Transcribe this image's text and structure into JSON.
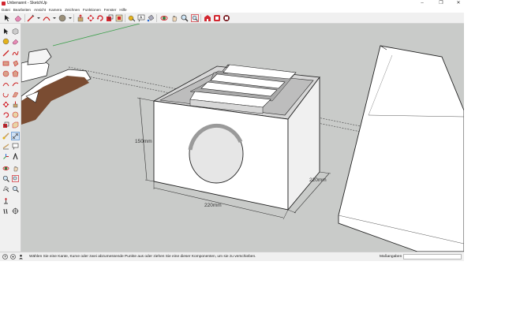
{
  "window": {
    "title": "Unbenannt - SketchUp",
    "min_glyph": "–",
    "max_glyph": "❐",
    "close_glyph": "✕"
  },
  "menu": [
    "Datei",
    "Bearbeiten",
    "Ansicht",
    "Kamera",
    "Zeichnen",
    "Funktionen",
    "Fenster",
    "Hilfe"
  ],
  "toolbar_icons": [
    "select-icon",
    "eraser-icon",
    "line-icon",
    "line-dropdown-icon",
    "arc-icon",
    "arc-dropdown-icon",
    "shape-icon",
    "shape-dropdown-icon",
    "pushpull-icon",
    "move-icon",
    "rotate-icon",
    "scale-icon",
    "offset-icon",
    "tape-measure-icon",
    "text-icon",
    "paint-bucket-icon",
    "orbit-icon",
    "pan-icon",
    "zoom-icon",
    "zoom-extents-icon",
    "warehouse-icon",
    "extension-warehouse-icon",
    "layout-icon"
  ],
  "left_icons": [
    "select-icon",
    "component-icon",
    "paint-bucket-icon",
    "eraser-icon",
    "line-icon",
    "freehand-icon",
    "rectangle-icon",
    "rotated-rectangle-icon",
    "circle-icon",
    "polygon-icon",
    "arc-icon",
    "pie-icon",
    "move-icon",
    "pushpull-icon",
    "rotate-icon",
    "followme-icon",
    "scale-icon",
    "offset-icon",
    "tape-measure-icon",
    "dimension-icon",
    "protractor-icon",
    "text-icon",
    "axes-icon",
    "3dtext-icon",
    "orbit-icon",
    "pan-icon",
    "zoom-icon",
    "zoom-window-icon",
    "zoom-extents-icon",
    "section-plane-icon",
    "walk-icon",
    "position-camera-icon",
    "look-around-icon"
  ],
  "model": {
    "dim_height": "150mm",
    "dim_width": "220mm",
    "dim_depth": "220mm"
  },
  "status": {
    "text": "Wählen Sie eine Kante, Kurve oder zwei abzumessende Punkte aus oder ziehen Sie eine dieser Komponenten, um sie zu verschieben.",
    "measure_label": "Maßangaben",
    "measure_value": ""
  },
  "colors": {
    "viewport_bg": "#c9cbc9",
    "accent_red": "#d2262f",
    "axis_green": "#3aa04a"
  }
}
